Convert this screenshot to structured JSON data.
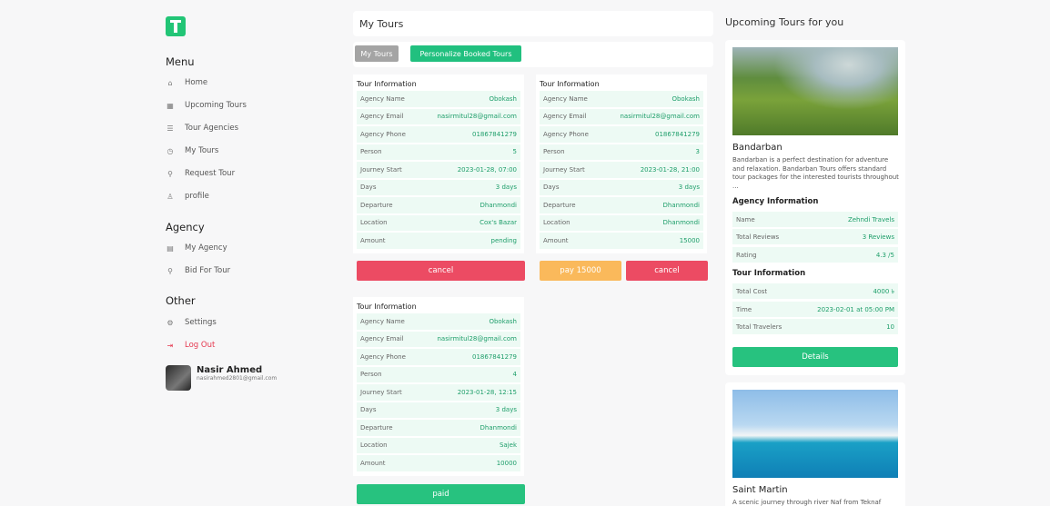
{
  "sidebar": {
    "menu_title": "Menu",
    "menu": [
      {
        "label": "Home",
        "icon": "home-icon",
        "glyph": "⌂"
      },
      {
        "label": "Upcoming Tours",
        "icon": "calendar-icon",
        "glyph": "▦"
      },
      {
        "label": "Tour Agencies",
        "icon": "list-icon",
        "glyph": "☰"
      },
      {
        "label": "My Tours",
        "icon": "clock-icon",
        "glyph": "◷"
      },
      {
        "label": "Request Tour",
        "icon": "route-icon",
        "glyph": "⚲"
      },
      {
        "label": "profile",
        "icon": "user-icon",
        "glyph": "♙"
      }
    ],
    "agency_title": "Agency",
    "agency": [
      {
        "label": "My Agency",
        "icon": "building-icon",
        "glyph": "▤"
      },
      {
        "label": "Bid For Tour",
        "icon": "route-icon",
        "glyph": "⚲"
      }
    ],
    "other_title": "Other",
    "other": [
      {
        "label": "Settings",
        "icon": "gear-icon",
        "glyph": "⚙"
      },
      {
        "label": "Log Out",
        "icon": "logout-icon",
        "glyph": "⇥"
      }
    ],
    "user": {
      "name": "Nasir Ahmed",
      "email": "nasirahmed2801@gmail.com"
    }
  },
  "header": {
    "title": "My Tours"
  },
  "tabs": {
    "my_tours": "My Tours",
    "personalize": "Personalize Booked Tours"
  },
  "card_title": "Tour Information",
  "labels": {
    "agency_name": "Agency Name",
    "agency_email": "Agency Email",
    "agency_phone": "Agency Phone",
    "person": "Person",
    "journey_start": "Journey Start",
    "days": "Days",
    "departure": "Departure",
    "location": "Location",
    "amount": "Amount"
  },
  "tours": [
    {
      "agency_name": "Obokash",
      "agency_email": "nasirmitul28@gmail.com",
      "agency_phone": "01867841279",
      "person": "5",
      "journey_start": "2023-01-28, 07:00",
      "days": "3 days",
      "departure": "Dhanmondi",
      "location": "Cox's Bazar",
      "amount": "pending",
      "cancel": "cancel"
    },
    {
      "agency_name": "Obokash",
      "agency_email": "nasirmitul28@gmail.com",
      "agency_phone": "01867841279",
      "person": "3",
      "journey_start": "2023-01-28, 21:00",
      "days": "3 days",
      "departure": "Dhanmondi",
      "location": "Dhanmondi",
      "amount": "15000",
      "pay": "pay 15000",
      "cancel": "cancel"
    },
    {
      "agency_name": "Obokash",
      "agency_email": "nasirmitul28@gmail.com",
      "agency_phone": "01867841279",
      "person": "4",
      "journey_start": "2023-01-28, 12:15",
      "days": "3 days",
      "departure": "Dhanmondi",
      "location": "Sajek",
      "amount": "10000",
      "paid": "paid"
    }
  ],
  "upcoming": {
    "title": "Upcoming Tours for you",
    "tours": [
      {
        "name": "Bandarban",
        "description": "Bandarban is a perfect destination for adventure and relaxation. Bandarban Tours offers standard tour packages for the interested tourists throughout ...",
        "agency_heading": "Agency Information",
        "agency": [
          {
            "k": "Name",
            "v": "Zehndi Travels"
          },
          {
            "k": "Total Reviews",
            "v": "3 Reviews"
          },
          {
            "k": "Rating",
            "v": "4.3 /5"
          }
        ],
        "tour_heading": "Tour Information",
        "tour": [
          {
            "k": "Total Cost",
            "v": "4000 ৳"
          },
          {
            "k": "Time",
            "v": "2023-02-01 at 05:00 PM"
          },
          {
            "k": "Total Travelers",
            "v": "10"
          }
        ],
        "details": "Details"
      },
      {
        "name": "Saint Martin",
        "description": "A scenic journey through river Naf from Teknaf"
      }
    ]
  }
}
